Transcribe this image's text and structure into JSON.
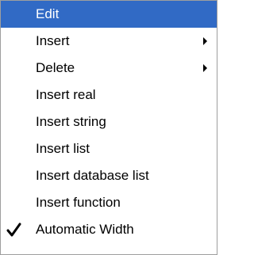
{
  "menu": {
    "items": [
      {
        "label": "Edit",
        "highlighted": true,
        "submenu": false,
        "checked": false
      },
      {
        "label": "Insert",
        "highlighted": false,
        "submenu": true,
        "checked": false
      },
      {
        "label": "Delete",
        "highlighted": false,
        "submenu": true,
        "checked": false
      },
      {
        "label": "Insert real",
        "highlighted": false,
        "submenu": false,
        "checked": false
      },
      {
        "label": "Insert string",
        "highlighted": false,
        "submenu": false,
        "checked": false
      },
      {
        "label": "Insert list",
        "highlighted": false,
        "submenu": false,
        "checked": false
      },
      {
        "label": "Insert database list",
        "highlighted": false,
        "submenu": false,
        "checked": false
      },
      {
        "label": "Insert function",
        "highlighted": false,
        "submenu": false,
        "checked": false
      },
      {
        "label": "Automatic Width",
        "highlighted": false,
        "submenu": false,
        "checked": true
      }
    ]
  },
  "colors": {
    "highlight": "#316ac5",
    "highlight_text": "#ffffff",
    "text": "#000000",
    "border": "#9e9e9e"
  },
  "icons": {
    "submenu": "submenu-arrow-icon",
    "check": "checkmark-icon"
  }
}
